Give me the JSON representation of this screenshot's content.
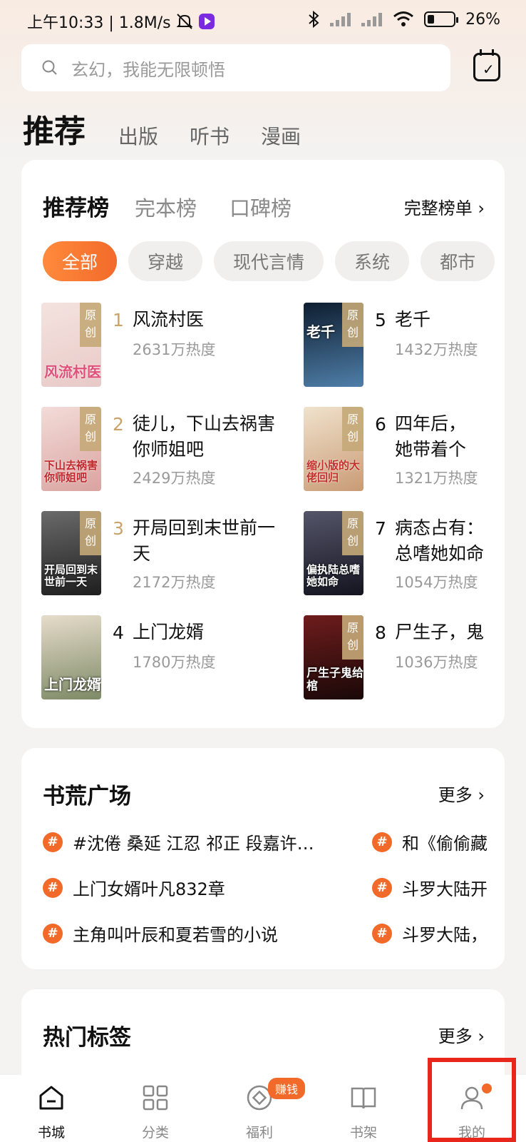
{
  "status_bar": {
    "time_speed": "上午10:33 | 1.8M/s",
    "battery": "26%",
    "battery_level": 0.26
  },
  "search": {
    "placeholder": "玄幻，我能无限顿悟"
  },
  "channel_tabs": [
    {
      "label": "推荐",
      "active": true
    },
    {
      "label": "出版",
      "active": false
    },
    {
      "label": "听书",
      "active": false
    },
    {
      "label": "漫画",
      "active": false
    }
  ],
  "ranking": {
    "tabs": [
      {
        "label": "推荐榜",
        "active": true
      },
      {
        "label": "完本榜",
        "active": false
      },
      {
        "label": "口碑榜",
        "active": false
      }
    ],
    "full_list_label": "完整榜单 ›",
    "filters": [
      {
        "label": "全部",
        "active": true
      },
      {
        "label": "穿越",
        "active": false
      },
      {
        "label": "现代言情",
        "active": false
      },
      {
        "label": "系统",
        "active": false
      },
      {
        "label": "都市",
        "active": false
      }
    ],
    "badge_text": "原创",
    "books": [
      {
        "rank": "1",
        "title": "风流村医",
        "heat": "2631万热度",
        "cover_text": "风流村医",
        "cover_color": "#e8c9c7"
      },
      {
        "rank": "2",
        "title": "徒儿，下山去祸害你师姐吧",
        "heat": "2429万热度",
        "cover_text": "下山去祸害你师姐吧",
        "cover_color": "#d9a3a0"
      },
      {
        "rank": "3",
        "title": "开局回到末世前一天",
        "heat": "2172万热度",
        "cover_text": "开局回到末世前一天",
        "cover_color": "#4a4a4a"
      },
      {
        "rank": "4",
        "title": "上门龙婿",
        "heat": "1780万热度",
        "cover_text": "上门龙婿",
        "cover_color": "#c7b697"
      },
      {
        "rank": "5",
        "title": "老千",
        "heat": "1432万热度",
        "cover_text": "老千",
        "cover_color": "#30506e"
      },
      {
        "rank": "6",
        "title": "四年后，她带着个缩小版的",
        "heat": "1321万热度",
        "cover_text": "缩小版的大佬回归",
        "cover_color": "#e0c3a6"
      },
      {
        "rank": "7",
        "title": "病态占有：总嗜她如命",
        "heat": "1054万热度",
        "cover_text": "偏执陆总嗜她如命",
        "cover_color": "#3a3a4a"
      },
      {
        "rank": "8",
        "title": "尸生子，鬼",
        "heat": "1036万热度",
        "cover_text": "尸生子鬼给棺",
        "cover_color": "#3a1616"
      }
    ]
  },
  "book_plaza": {
    "title": "书荒广场",
    "more_label": "更多 ›",
    "topics_left": [
      "#沈倦 桑延 江忍 祁正 段嘉许…",
      "上门女婿叶凡832章",
      "主角叫叶辰和夏若雪的小说"
    ],
    "topics_right": [
      "和《偷偷藏",
      "斗罗大陆开",
      "斗罗大陆，"
    ]
  },
  "hot_tags": {
    "title": "热门标签",
    "more_label": "更多 ›"
  },
  "bottom_nav": [
    {
      "label": "书城",
      "icon": "home-icon",
      "active": true
    },
    {
      "label": "分类",
      "icon": "grid-icon",
      "active": false
    },
    {
      "label": "福利",
      "icon": "coin-icon",
      "active": false
    },
    {
      "label": "书架",
      "icon": "book-icon",
      "active": false
    },
    {
      "label": "我的",
      "icon": "user-icon",
      "active": false
    }
  ],
  "earn_badge": "赚钱",
  "colors": {
    "accent": "#f26a2a",
    "highlight_box": "#e8261c",
    "rank_gold": "#c9a36a"
  }
}
